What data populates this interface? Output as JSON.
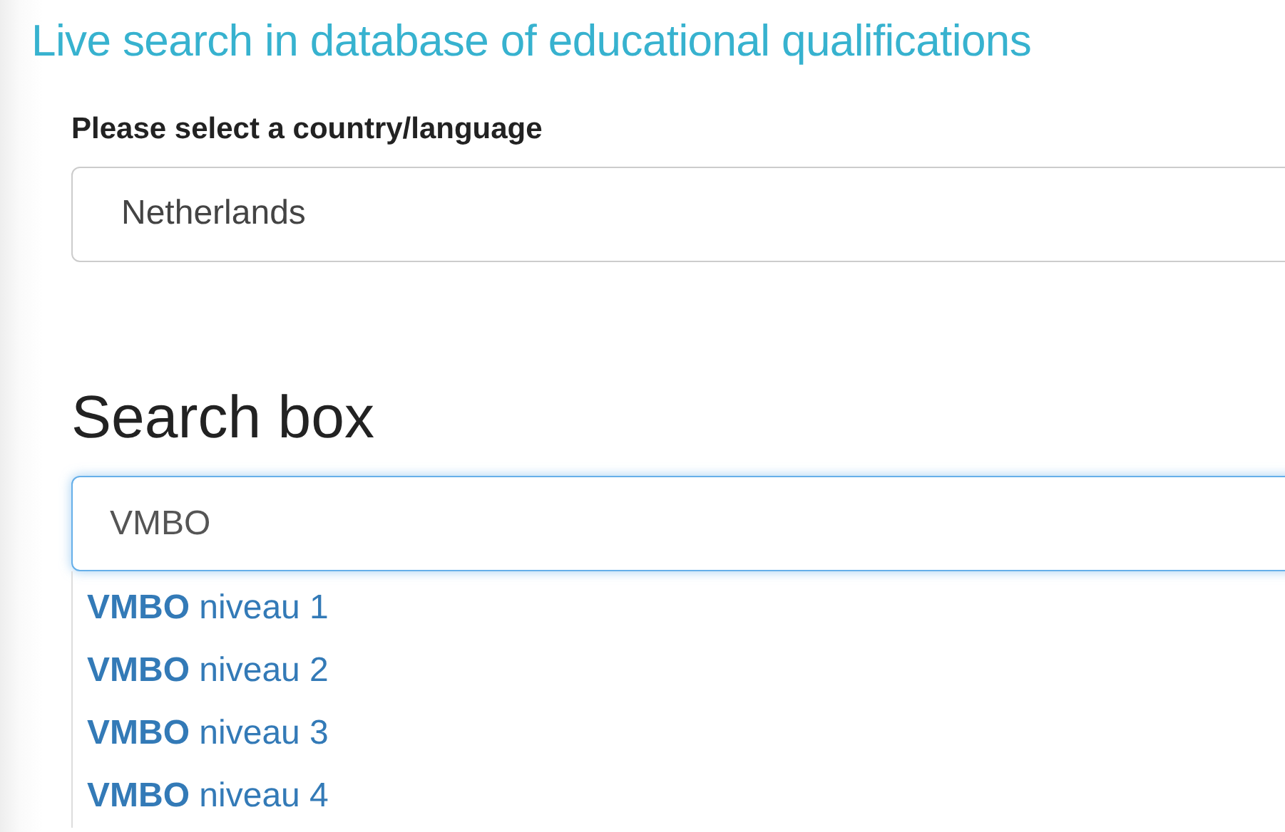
{
  "title": "Live search in database of educational qualifications",
  "country_select": {
    "label": "Please select a country/language",
    "value": "Netherlands"
  },
  "search": {
    "heading": "Search box",
    "value": "VMBO",
    "focused": true
  },
  "suggestions": [
    {
      "text": "**VMBO** niveau 1"
    },
    {
      "text": "**VMBO** niveau 2"
    },
    {
      "text": "**VMBO** niveau 3"
    },
    {
      "text": "**VMBO** niveau 4"
    }
  ]
}
